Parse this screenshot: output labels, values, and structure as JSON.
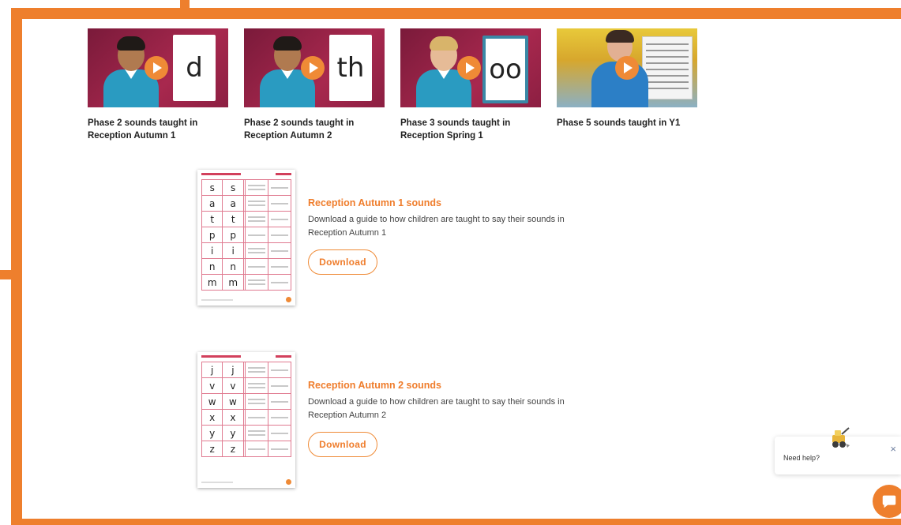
{
  "videos": [
    {
      "title": "Phase 2 sounds taught in Reception Autumn 1",
      "card_text": "d",
      "thumb": "child-with-letter-card"
    },
    {
      "title": "Phase 2 sounds taught in Reception Autumn 2",
      "card_text": "th",
      "thumb": "child-with-letter-card"
    },
    {
      "title": "Phase 3 sounds taught in Reception Spring 1",
      "card_text": "oo",
      "thumb": "child-with-letter-card"
    },
    {
      "title": "Phase 5 sounds taught in Y1",
      "card_text": "",
      "thumb": "teacher-in-classroom"
    }
  ],
  "resources": [
    {
      "title": "Reception Autumn 1 sounds",
      "description": "Download a guide to how children are taught to say their sounds in Reception Autumn 1",
      "button": "Download",
      "sheet_letters": [
        "s",
        "a",
        "t",
        "p",
        "i",
        "n",
        "m"
      ]
    },
    {
      "title": "Reception Autumn 2 sounds",
      "description": "Download a guide to how children are taught to say their sounds in Reception Autumn 2",
      "button": "Download",
      "sheet_letters": [
        "j",
        "v",
        "w",
        "x",
        "y",
        "z"
      ]
    }
  ],
  "help_widget": {
    "text": "Need help?",
    "close": "×",
    "icon": "chat-bubble-icon"
  },
  "colors": {
    "accent": "#ee7f2d",
    "title_orange": "#ef7d2c"
  }
}
